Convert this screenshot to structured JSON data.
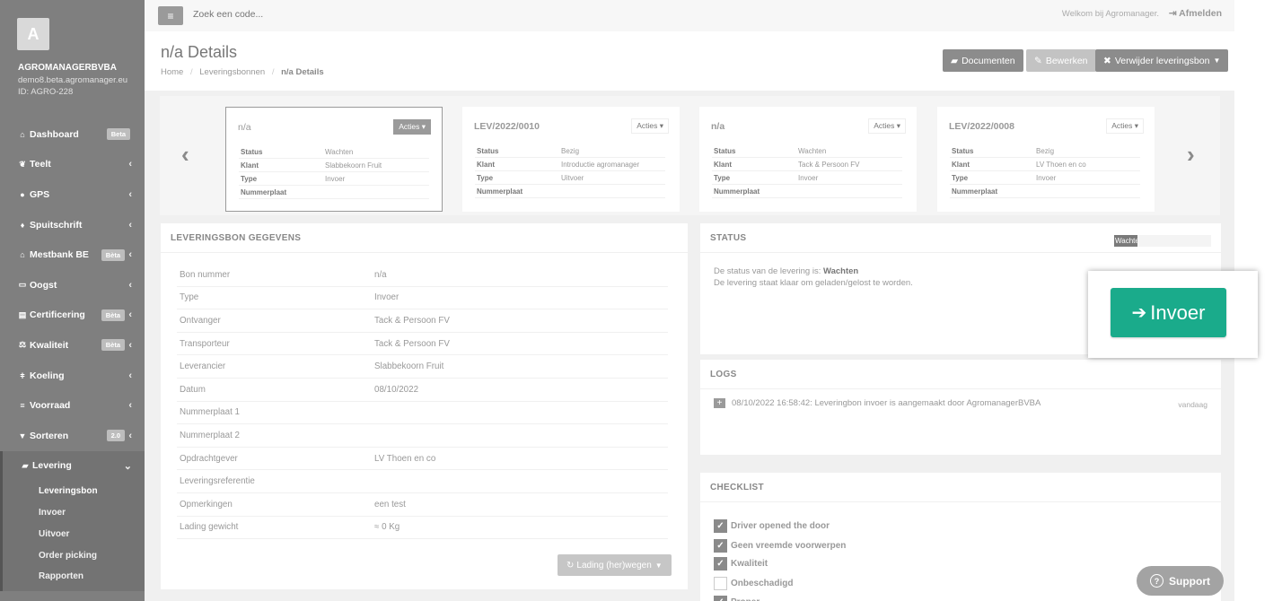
{
  "sidebar": {
    "avatar_letter": "A",
    "company": "AGROMANAGERBVBA",
    "domain": "demo8.beta.agromanager.eu",
    "client_id": "ID: AGRO-228",
    "items": [
      {
        "label": "Dashboard",
        "icon": "home-icon",
        "badge": "Beta"
      },
      {
        "label": "Teelt",
        "icon": "leaf-icon"
      },
      {
        "label": "GPS",
        "icon": "map-marker-icon"
      },
      {
        "label": "Spuitschrift",
        "icon": "droplet-icon"
      },
      {
        "label": "Mestbank BE",
        "icon": "bank-icon",
        "badge": "Bèta"
      },
      {
        "label": "Oogst",
        "icon": "basket-icon"
      },
      {
        "label": "Certificering",
        "icon": "certificate-icon",
        "badge": "Bèta"
      },
      {
        "label": "Kwaliteit",
        "icon": "scale-icon",
        "badge": "Bèta"
      },
      {
        "label": "Koeling",
        "icon": "thermometer-icon"
      },
      {
        "label": "Voorraad",
        "icon": "list-icon"
      },
      {
        "label": "Sorteren",
        "icon": "filter-icon",
        "badge": "2.0"
      },
      {
        "label": "Levering",
        "icon": "truck-icon"
      }
    ],
    "submenu": [
      "Leveringsbon",
      "Invoer",
      "Uitvoer",
      "Order picking",
      "Rapporten"
    ]
  },
  "topbar": {
    "search_placeholder": "Zoek een code...",
    "welcome": "Welkom bij Agromanager.",
    "logout": "Afmelden"
  },
  "header": {
    "title": "n/a Details",
    "breadcrumb": [
      "Home",
      "Leveringsbonnen",
      "n/a Details"
    ],
    "buttons": {
      "documents": "Documenten",
      "edit": "Bewerken",
      "delete": "Verwijder leveringsbon"
    }
  },
  "carousel": {
    "labels": {
      "status": "Status",
      "klant": "Klant",
      "type": "Type",
      "nummerplaat": "Nummerplaat"
    },
    "actions_label": "Acties",
    "cards": [
      {
        "title": "n/a",
        "status": "Wachten",
        "klant": "Slabbekoorn Fruit",
        "type": "Invoer",
        "nummerplaat": ""
      },
      {
        "title": "LEV/2022/0010",
        "status": "Bezig",
        "klant": "Introductie agromanager",
        "type": "Uitvoer",
        "nummerplaat": ""
      },
      {
        "title": "n/a",
        "status": "Wachten",
        "klant": "Tack & Persoon FV",
        "type": "Invoer",
        "nummerplaat": ""
      },
      {
        "title": "LEV/2022/0008",
        "status": "Bezig",
        "klant": "LV Thoen en co",
        "type": "Invoer",
        "nummerplaat": ""
      }
    ]
  },
  "gegevens": {
    "title": "LEVERINGSBON GEGEVENS",
    "rows": [
      {
        "k": "Bon nummer",
        "v": "n/a"
      },
      {
        "k": "Type",
        "v": "Invoer"
      },
      {
        "k": "Ontvanger",
        "v": "Tack & Persoon FV"
      },
      {
        "k": "Transporteur",
        "v": "Tack & Persoon FV"
      },
      {
        "k": "Leverancier",
        "v": "Slabbekoorn Fruit"
      },
      {
        "k": "Datum",
        "v": "08/10/2022"
      },
      {
        "k": "Nummerplaat 1",
        "v": ""
      },
      {
        "k": "Nummerplaat 2",
        "v": ""
      },
      {
        "k": "Opdrachtgever",
        "v": "LV Thoen en co"
      },
      {
        "k": "Leveringsreferentie",
        "v": ""
      },
      {
        "k": "Opmerkingen",
        "v": "een test"
      },
      {
        "k": "Lading gewicht",
        "v": "≈ 0 Kg"
      }
    ],
    "lading_button": "Lading (her)wegen"
  },
  "status": {
    "title": "STATUS",
    "bar_label": "Wachten",
    "progress": 0.24,
    "line1_prefix": "De status van de levering is:",
    "line1_value": "Wachten",
    "line2": "De levering staat klaar om geladen/gelost te worden."
  },
  "logs": {
    "title": "LOGS",
    "entry": "08/10/2022 16:58:42: Leveringbon invoer is aangemaakt door AgromanagerBVBA",
    "time": "vandaag"
  },
  "checklist": {
    "title": "CHECKLIST",
    "items": [
      {
        "label": "Driver opened the door",
        "checked": true
      },
      {
        "label": "Geen vreemde voorwerpen",
        "checked": true
      },
      {
        "label": "Kwaliteit",
        "checked": true
      },
      {
        "label": "Onbeschadigd",
        "checked": false
      },
      {
        "label": "Proper",
        "checked": true
      }
    ]
  },
  "highlight": {
    "button": "Invoer"
  },
  "support": "Support",
  "colors": {
    "accent": "#1aab8b",
    "sidebar": "#7f7f7f"
  }
}
